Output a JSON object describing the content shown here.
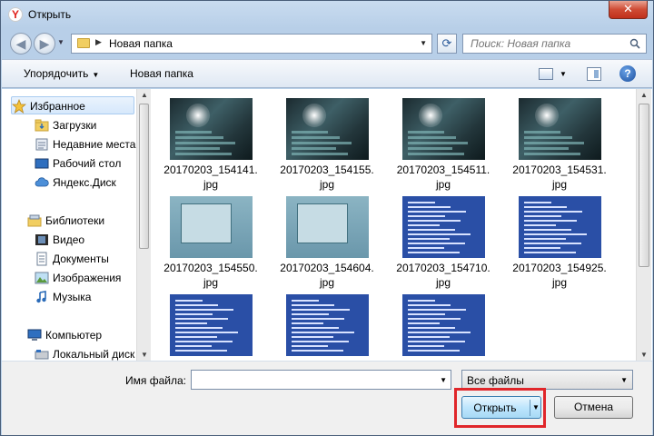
{
  "window": {
    "title": "Открыть",
    "app_icon": "Y",
    "close_glyph": "✕"
  },
  "address_bar": {
    "path": "Новая папка",
    "search_placeholder": "Поиск: Новая папка"
  },
  "toolbar": {
    "organize_label": "Упорядочить",
    "new_folder_label": "Новая папка",
    "help_glyph": "?"
  },
  "navigation": {
    "items": [
      {
        "label": "Избранное",
        "icon": "star-icon",
        "selected": true
      },
      {
        "label": "Загрузки",
        "icon": "downloads-folder-icon"
      },
      {
        "label": "Недавние места",
        "icon": "recent-places-icon"
      },
      {
        "label": "Рабочий стол",
        "icon": "desktop-icon"
      },
      {
        "label": "Яндекс.Диск",
        "icon": "cloud-icon"
      },
      {
        "label": "Библиотеки",
        "icon": "libraries-icon"
      },
      {
        "label": "Видео",
        "icon": "video-icon"
      },
      {
        "label": "Документы",
        "icon": "documents-icon"
      },
      {
        "label": "Изображения",
        "icon": "pictures-icon"
      },
      {
        "label": "Музыка",
        "icon": "music-icon"
      },
      {
        "label": "Компьютер",
        "icon": "computer-icon"
      },
      {
        "label": "Локальный диск",
        "icon": "drive-icon"
      }
    ]
  },
  "files": [
    {
      "name_line1": "20170203_154141.",
      "name_line2": "jpg",
      "thumb": "dark"
    },
    {
      "name_line1": "20170203_154155.",
      "name_line2": "jpg",
      "thumb": "dark"
    },
    {
      "name_line1": "20170203_154511.",
      "name_line2": "jpg",
      "thumb": "dark"
    },
    {
      "name_line1": "20170203_154531.",
      "name_line2": "jpg",
      "thumb": "dark"
    },
    {
      "name_line1": "20170203_154550.",
      "name_line2": "jpg",
      "thumb": "gray"
    },
    {
      "name_line1": "20170203_154604.",
      "name_line2": "jpg",
      "thumb": "gray"
    },
    {
      "name_line1": "20170203_154710.",
      "name_line2": "jpg",
      "thumb": "bios"
    },
    {
      "name_line1": "20170203_154925.",
      "name_line2": "jpg",
      "thumb": "bios"
    },
    {
      "name_line1": "",
      "name_line2": "",
      "thumb": "bios"
    },
    {
      "name_line1": "",
      "name_line2": "",
      "thumb": "bios"
    },
    {
      "name_line1": "",
      "name_line2": "",
      "thumb": "bios"
    }
  ],
  "bottom": {
    "filename_label": "Имя файла:",
    "filename_value": "",
    "filter_value": "Все файлы",
    "open_label": "Открыть",
    "cancel_label": "Отмена"
  },
  "colors": {
    "highlight": "#e0262a",
    "accent": "#3c7fb1"
  }
}
